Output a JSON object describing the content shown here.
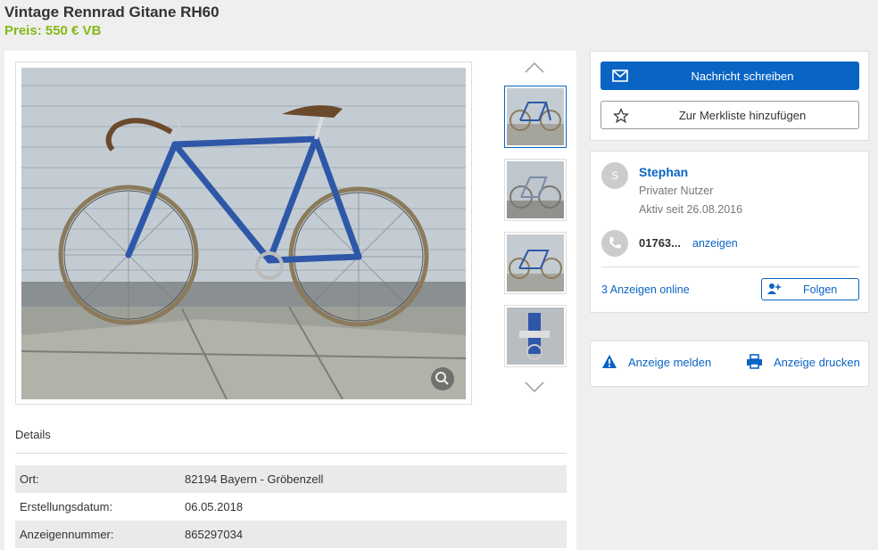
{
  "listing": {
    "title": "Vintage Rennrad Gitane RH60",
    "price": "Preis: 550 € VB"
  },
  "gallery": {
    "zoom_icon": "zoom-icon",
    "thumbnails": 4
  },
  "details": {
    "heading": "Details",
    "rows": [
      {
        "label": "Ort:",
        "value": "82194 Bayern - Gröbenzell"
      },
      {
        "label": "Erstellungsdatum:",
        "value": "06.05.2018"
      },
      {
        "label": "Anzeigennummer:",
        "value": "865297034"
      }
    ]
  },
  "contact": {
    "message_label": "Nachricht schreiben",
    "watchlist_label": "Zur Merkliste hinzufügen"
  },
  "seller": {
    "initial": "S",
    "name": "Stephan",
    "type": "Privater Nutzer",
    "active_since": "Aktiv seit 26.08.2016",
    "phone": "01763...",
    "phone_reveal": "anzeigen",
    "ads_online": "3 Anzeigen online",
    "follow_label": "Folgen"
  },
  "actions": {
    "report_label": "Anzeige melden",
    "print_label": "Anzeige drucken"
  },
  "colors": {
    "brand_blue": "#0a64c4",
    "price_green": "#86b817",
    "bike_blue": "#2f57a8"
  }
}
